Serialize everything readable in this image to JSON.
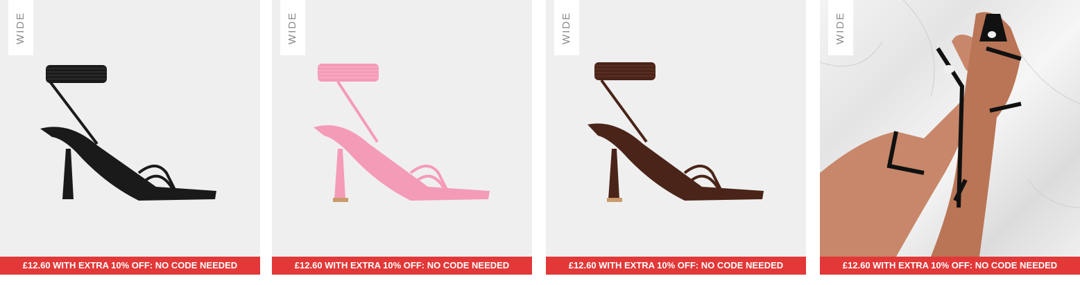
{
  "products": [
    {
      "badge": "WIDE",
      "promo": "£12.60 WITH EXTRA 10% OFF: NO CODE NEEDED",
      "color": "#1a1a1a",
      "icon": "black-strappy-heel"
    },
    {
      "badge": "WIDE",
      "promo": "£12.60 WITH EXTRA 10% OFF: NO CODE NEEDED",
      "color": "#f49bb8",
      "icon": "pink-strappy-heel"
    },
    {
      "badge": "WIDE",
      "promo": "£12.60 WITH EXTRA 10% OFF: NO CODE NEEDED",
      "color": "#4a2418",
      "icon": "brown-strappy-heel"
    },
    {
      "badge": "WIDE",
      "promo": "£12.60 WITH EXTRA 10% OFF: NO CODE NEEDED",
      "color": "#111111",
      "icon": "black-heel-on-model"
    }
  ]
}
